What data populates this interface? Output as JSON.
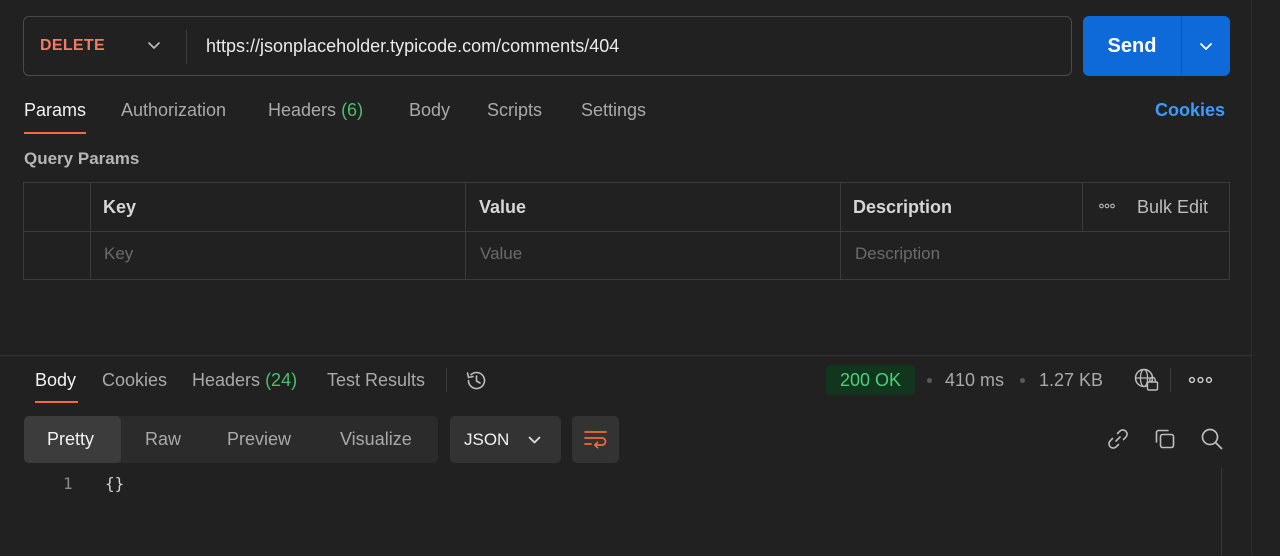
{
  "request": {
    "method": "DELETE",
    "url": "https://jsonplaceholder.typicode.com/comments/404",
    "send_label": "Send"
  },
  "request_tabs": [
    {
      "label": "Params",
      "active": true
    },
    {
      "label": "Authorization"
    },
    {
      "label": "Headers",
      "count": "(6)"
    },
    {
      "label": "Body"
    },
    {
      "label": "Scripts"
    },
    {
      "label": "Settings"
    }
  ],
  "cookies_link": "Cookies",
  "query_params": {
    "title": "Query Params",
    "columns": [
      "Key",
      "Value",
      "Description"
    ],
    "bulk_edit": "Bulk Edit",
    "placeholders": {
      "key": "Key",
      "value": "Value",
      "description": "Description"
    }
  },
  "response_tabs": [
    {
      "label": "Body",
      "active": true
    },
    {
      "label": "Cookies"
    },
    {
      "label": "Headers",
      "count": "(24)"
    },
    {
      "label": "Test Results"
    }
  ],
  "response_meta": {
    "status": "200 OK",
    "time": "410 ms",
    "size": "1.27 KB"
  },
  "view_modes": [
    "Pretty",
    "Raw",
    "Preview",
    "Visualize"
  ],
  "format": "JSON",
  "code": {
    "line_number": "1",
    "text": "{}"
  },
  "colors": {
    "accent": "#f26b3a",
    "send": "#0e6ad8",
    "method": "#f27b68",
    "status_ok": "#4cd07b",
    "count": "#47c26b",
    "link": "#3c9bff"
  },
  "icons": [
    "chevron-down-icon",
    "history-icon",
    "globe-lock-icon",
    "more-icon",
    "wrap-lines-icon",
    "link-icon",
    "copy-icon",
    "search-icon"
  ]
}
